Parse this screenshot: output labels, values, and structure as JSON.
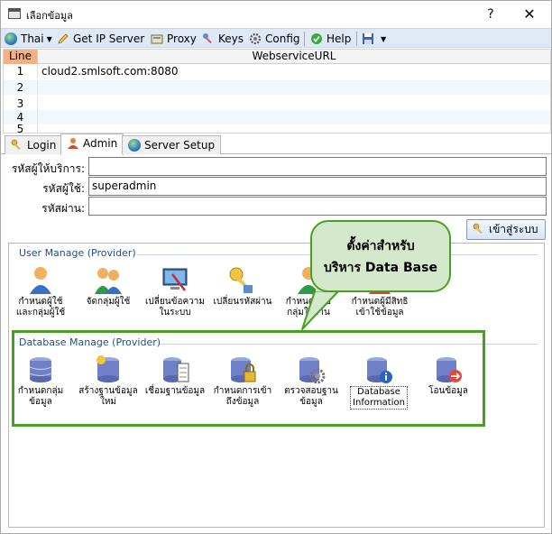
{
  "window": {
    "title": "เลือกข้อมูล",
    "help_glyph": "?",
    "close_glyph": "✕"
  },
  "toolbar": {
    "language_label": "Thai",
    "get_ip_label": "Get IP Server",
    "proxy_label": "Proxy",
    "keys_label": "Keys",
    "config_label": "Config",
    "help_label": "Help"
  },
  "grid": {
    "col_line": "Line",
    "col_url": "WebserviceURL",
    "rows": [
      {
        "num": "1",
        "url": "cloud2.smlsoft.com:8080"
      },
      {
        "num": "2",
        "url": ""
      },
      {
        "num": "3",
        "url": ""
      },
      {
        "num": "4",
        "url": ""
      },
      {
        "num": "5",
        "url": ""
      }
    ]
  },
  "tabs": {
    "login": "Login",
    "admin": "Admin",
    "server_setup": "Server Setup"
  },
  "form": {
    "provider_label": "รหัสผู้ให้บริการ:",
    "provider_value": "",
    "user_label": "รหัสผู้ใช้:",
    "user_value": "superadmin",
    "password_label": "รหัสผ่าน:",
    "password_value": "",
    "login_button": "เข้าสู่ระบบ"
  },
  "user_manage": {
    "title": "User Manage (Provider)",
    "items": [
      {
        "label": "กำหนดผู้ใช้\nและกลุ่มผู้ใช้"
      },
      {
        "label": "จัดกลุ่มผู้ใช้"
      },
      {
        "label": "เปลี่ยนข้อความ\nในระบบ"
      },
      {
        "label": "เปลี่ยนรหัสผ่าน"
      },
      {
        "label": "กำหนดสิทธิ\nกลุ่มใช้งาน"
      },
      {
        "label": "กำหนดผู้มีสิทธิ\nเข้าใช้ข้อมูล"
      }
    ]
  },
  "database_manage": {
    "title": "Database Manage (Provider)",
    "items": [
      {
        "label": "กำหนดกลุ่ม\nข้อมูล"
      },
      {
        "label": "สร้างฐานข้อมูล\nใหม่"
      },
      {
        "label": "เชื่อมฐานข้อมูล"
      },
      {
        "label": "กำหนดการเข้า\nถึงข้อมูล"
      },
      {
        "label": "ตรวจสอบฐาน\nข้อมูล"
      },
      {
        "label": "Database\nInformation"
      },
      {
        "label": "โอนข้อมูล"
      }
    ]
  },
  "callout": {
    "line1": "ตั้งค่าสำหรับ",
    "line2": "บริหาร Data Base"
  },
  "colors": {
    "highlight": "#4b9e24",
    "callout_fill": "#d4e8cc",
    "grid_header_accent": "#f4b183",
    "toolbar_bg": "#dfe9f5"
  }
}
